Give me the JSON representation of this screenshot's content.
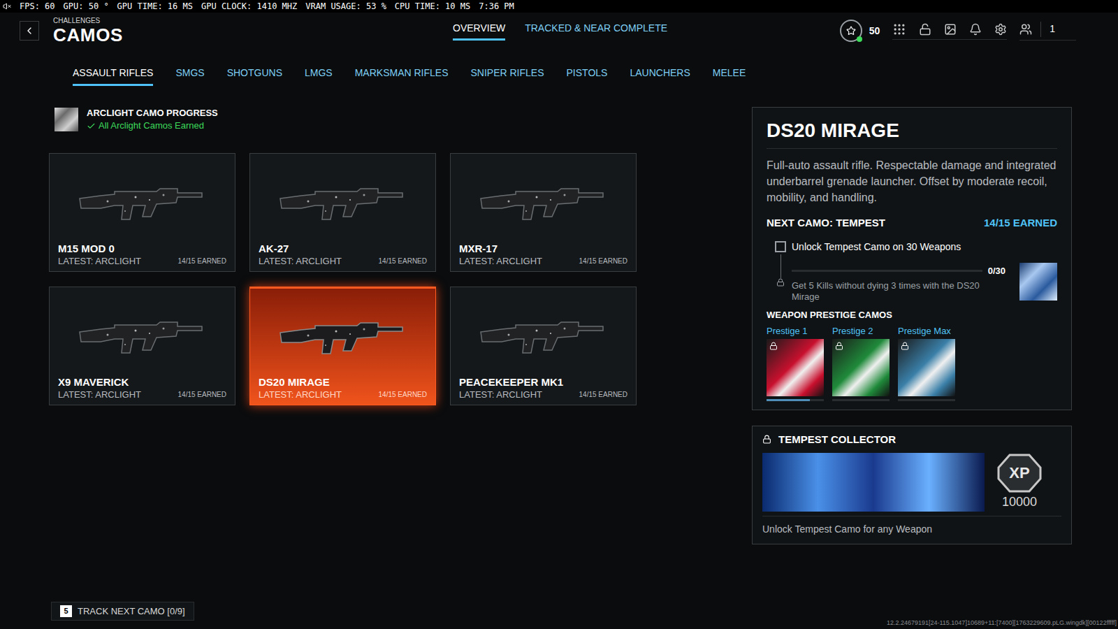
{
  "overlay": {
    "stats": [
      "FPS: 60",
      "GPU: 50 °",
      "GPU TIME: 16 MS",
      "GPU CLOCK: 1410 MHZ",
      "VRAM USAGE: 53 %",
      "CPU TIME: 10 MS",
      "7:36 PM"
    ],
    "muted": true
  },
  "header": {
    "breadcrumb": "CHALLENGES",
    "title": "CAMOS",
    "tabs": [
      {
        "label": "OVERVIEW",
        "selected": true
      },
      {
        "label": "TRACKED & NEAR COMPLETE",
        "selected": false
      }
    ],
    "level": "50",
    "notifications": "1"
  },
  "categories": [
    {
      "label": "ASSAULT RIFLES",
      "selected": true
    },
    {
      "label": "SMGS",
      "selected": false
    },
    {
      "label": "SHOTGUNS",
      "selected": false
    },
    {
      "label": "LMGS",
      "selected": false
    },
    {
      "label": "MARKSMAN RIFLES",
      "selected": false
    },
    {
      "label": "SNIPER RIFLES",
      "selected": false
    },
    {
      "label": "PISTOLS",
      "selected": false
    },
    {
      "label": "LAUNCHERS",
      "selected": false
    },
    {
      "label": "MELEE",
      "selected": false
    }
  ],
  "camo_progress": {
    "title": "ARCLIGHT CAMO PROGRESS",
    "status": "All Arclight Camos Earned",
    "complete": true
  },
  "weapons": [
    {
      "name": "M15 MOD 0",
      "latest": "LATEST: ARCLIGHT",
      "earned": "14/15 EARNED",
      "selected": false
    },
    {
      "name": "AK-27",
      "latest": "LATEST: ARCLIGHT",
      "earned": "14/15 EARNED",
      "selected": false
    },
    {
      "name": "MXR-17",
      "latest": "LATEST: ARCLIGHT",
      "earned": "14/15 EARNED",
      "selected": false
    },
    {
      "name": "X9 MAVERICK",
      "latest": "LATEST: ARCLIGHT",
      "earned": "14/15 EARNED",
      "selected": false
    },
    {
      "name": "DS20 MIRAGE",
      "latest": "LATEST: ARCLIGHT",
      "earned": "14/15 EARNED",
      "selected": true
    },
    {
      "name": "PEACEKEEPER MK1",
      "latest": "LATEST: ARCLIGHT",
      "earned": "14/15 EARNED",
      "selected": false
    }
  ],
  "detail": {
    "name": "DS20 MIRAGE",
    "description": "Full-auto assault rifle. Respectable damage and integrated underbarrel grenade launcher. Offset by moderate recoil, mobility, and handling.",
    "next_camo": "NEXT CAMO: TEMPEST",
    "earned": "14/15 EARNED",
    "challenge": {
      "label": "Unlock Tempest Camo on 30 Weapons",
      "checked": false,
      "progress": "0/30",
      "level": 0,
      "sub": "Get 5 Kills without dying 3 times with the DS20 Mirage",
      "locked": true
    },
    "prestige_title": "WEAPON PRESTIGE CAMOS",
    "prestige": [
      {
        "label": "Prestige 1",
        "locked": true,
        "level": 0.75,
        "color": "#c8102e"
      },
      {
        "label": "Prestige 2",
        "locked": true,
        "level": 0,
        "color": "#1f8a3a"
      },
      {
        "label": "Prestige Max",
        "locked": true,
        "level": 0,
        "color": "#3a7fa8"
      }
    ]
  },
  "collector": {
    "title": "TEMPEST COLLECTOR",
    "locked": true,
    "reward": "XP",
    "xp": "10000",
    "description": "Unlock Tempest Camo for any Weapon"
  },
  "footer": {
    "key": "5",
    "label": "TRACK NEXT CAMO [0/9]",
    "build": "12.2.24679191[24-115.1047]10689+11:[7400][1763229609.pLG.wingdk][00122fffff]"
  }
}
